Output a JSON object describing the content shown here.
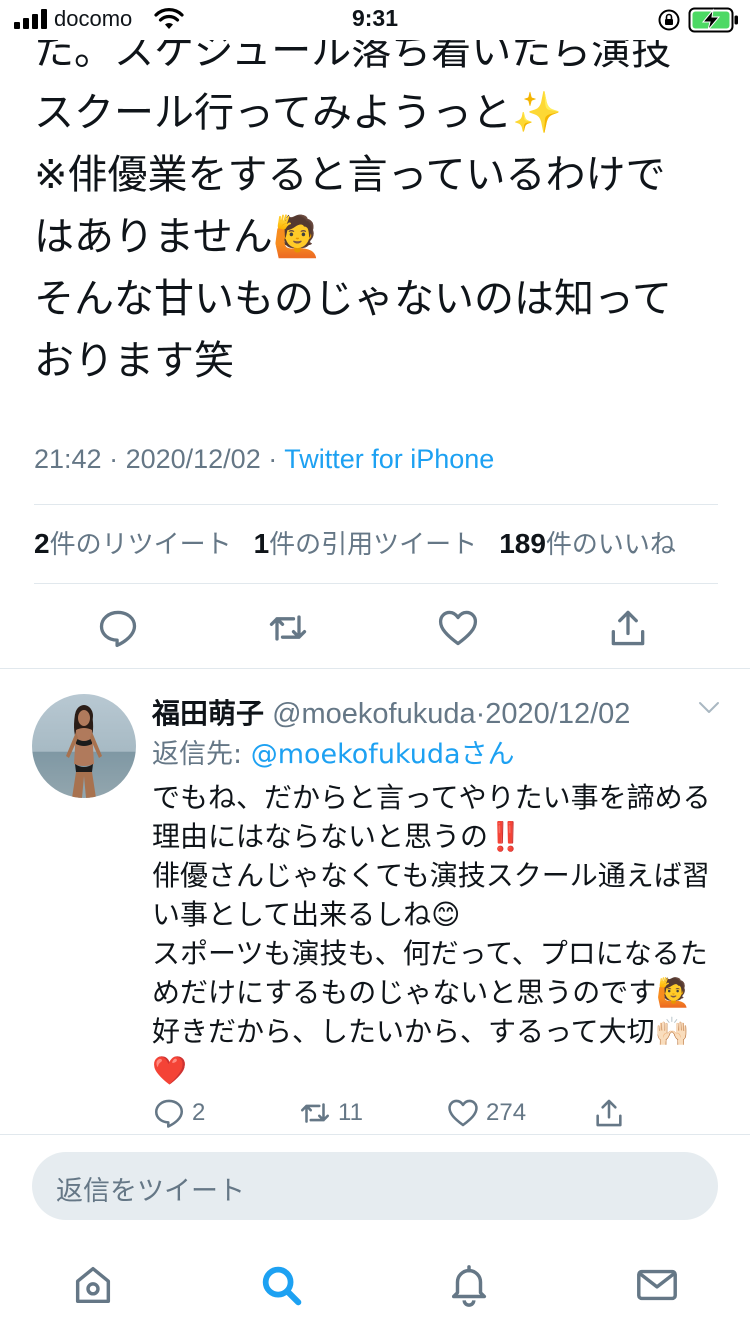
{
  "status": {
    "carrier": "docomo",
    "time": "9:31"
  },
  "tweet": {
    "text": "た。スケジュール落ち着いたら演技\nスクール行ってみようっと✨\n※俳優業をすると言っているわけで\nはありません🙋\nそんな甘いものじゃないのは知って\nおります笑",
    "time": "21:42",
    "sep1": " · ",
    "date": "2020/12/02",
    "sep2": " · ",
    "source": "Twitter for iPhone",
    "retweet_count": "2",
    "retweet_label": "件のリツイート",
    "quote_count": "1",
    "quote_label": "件の引用ツイート",
    "like_count": "189",
    "like_label": "件のいいね"
  },
  "reply": {
    "name": "福田萌子",
    "handle": " @moekofukuda",
    "dot": "·",
    "date": "2020/12/02",
    "reply_to_label": "返信先: ",
    "reply_to_user": "@moekofukudaさん",
    "text": "でもね、だからと言ってやりたい事を諦める\n理由にはならないと思うの‼️\n俳優さんじゃなくても演技スクール通えば習\nい事として出来るしね😊\nスポーツも演技も、何だって、プロになるた\nめだけにするものじゃないと思うのです🙋\n好きだから、したいから、するって大切🙌🏻\n❤️",
    "reply_count": "2",
    "retweet_count": "11",
    "like_count": "274"
  },
  "compose": {
    "placeholder": "返信をツイート"
  },
  "colors": {
    "accent": "#1da1f2",
    "secondary_text": "#657786",
    "divider": "#e1e8ed",
    "compose_bg": "#e6ecf0"
  },
  "icons": [
    "signal-icon",
    "wifi-icon",
    "lock-rotation-icon",
    "battery-charging-icon",
    "reply-icon",
    "retweet-icon",
    "like-icon",
    "share-icon",
    "chevron-down-icon",
    "home-icon",
    "search-icon",
    "notifications-icon",
    "messages-icon"
  ]
}
